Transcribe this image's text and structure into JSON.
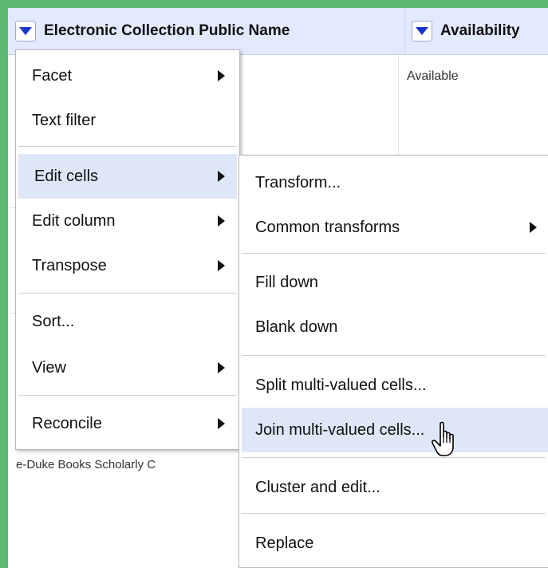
{
  "columns": [
    {
      "name": "Electronic Collection Public Name"
    },
    {
      "name": "Availability"
    }
  ],
  "cells": {
    "availability": "Available",
    "collection_snippet": "e-Duke Books Scholarly C"
  },
  "column_menu": {
    "items": [
      {
        "label": "Facet",
        "submenu": true
      },
      {
        "label": "Text filter",
        "submenu": false
      },
      {
        "label": "Edit cells",
        "submenu": true,
        "highlighted": true
      },
      {
        "label": "Edit column",
        "submenu": true
      },
      {
        "label": "Transpose",
        "submenu": true
      },
      {
        "label": "Sort...",
        "submenu": false
      },
      {
        "label": "View",
        "submenu": true
      },
      {
        "label": "Reconcile",
        "submenu": true
      }
    ]
  },
  "edit_cells_menu": {
    "items": [
      {
        "label": "Transform...",
        "submenu": false
      },
      {
        "label": "Common transforms",
        "submenu": true
      },
      {
        "label": "Fill down",
        "submenu": false
      },
      {
        "label": "Blank down",
        "submenu": false
      },
      {
        "label": "Split multi-valued cells...",
        "submenu": false
      },
      {
        "label": "Join multi-valued cells...",
        "submenu": false,
        "highlighted": true
      },
      {
        "label": "Cluster and edit...",
        "submenu": false
      },
      {
        "label": "Replace",
        "submenu": false
      }
    ]
  },
  "colors": {
    "background": "#5db870",
    "header": "#e3e9ff",
    "dropdown_triangle": "#1a35c9",
    "menu_highlight": "#dde7f7"
  },
  "icons": {
    "dropdown": "chevron-down-icon",
    "submenu": "chevron-right-icon",
    "pointer": "hand-pointer-icon"
  }
}
